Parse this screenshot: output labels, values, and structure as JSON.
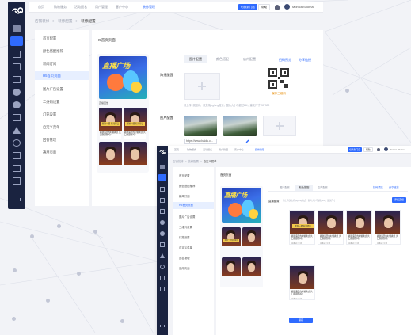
{
  "colors": {
    "accent": "#2f6bff",
    "sidebar": "#1a2340",
    "warning": "#e68a00"
  },
  "window1": {
    "topnav": [
      "首页",
      "购物服务",
      "活动报名",
      "用户管理",
      "客户中心",
      "装修管理"
    ],
    "topnav_active_index": 5,
    "top_buttons": {
      "primary": "切换到门店",
      "secondary": "帮助"
    },
    "user_name": "Monica Shoma",
    "breadcrumb": [
      "店铺装修",
      "装修配置",
      "装修配置"
    ],
    "menu": [
      "首页配置",
      "颜色搭配推荐",
      "新闻订阅",
      "H5首页页面",
      "图片广告设置",
      "二维码设置",
      "灯笼设置",
      "自定义菜单",
      "回答管理",
      "通用页面"
    ],
    "menu_active_index": 3,
    "main_title": "H5首页页面",
    "phone": {
      "banner_title": "直播广场",
      "strip_text": "直播回放",
      "card_ribbon": "刚准一把\n有闻得口",
      "card_caption": "刷新露天的时候换点\n共口新颜色吗？"
    },
    "tabs": [
      "图片配置",
      "颜色搭配",
      "店内配置"
    ],
    "tab_active_index": 0,
    "links": {
      "share": "扫码预览",
      "edit": "分享链接"
    },
    "labels": {
      "banner": "海报配置",
      "image": "图片配置"
    },
    "hint": "请上传1张图片，仅支持jpg/png格式，图片大小不超过2M，建议尺寸750*300",
    "qr_text": "保存二维码",
    "url_value": "https://www.baidu.c..."
  },
  "window2": {
    "topnav": [
      "首页",
      "购物服务",
      "活动报名",
      "用户管理",
      "客户中心",
      "装修管理"
    ],
    "topnav_active_index": 5,
    "top_buttons": {
      "primary": "切换到门店",
      "secondary": "帮助"
    },
    "user_name": "Monica Shoma",
    "breadcrumb": [
      "店铺装修",
      "装修配置",
      "自定义菜单"
    ],
    "menu": [
      "首页配置",
      "颜色搭配推荐",
      "新闻订阅",
      "H5首页页面",
      "图片广告设置",
      "二维码设置",
      "灯笼设置",
      "自定义菜单",
      "回答管理",
      "通用页面"
    ],
    "menu_active_index": 3,
    "main_title": "首页页面",
    "tabs": [
      "图片配置",
      "颜色搭配",
      "店内配置"
    ],
    "tab_active_index": 1,
    "links": {
      "share": "扫码预览",
      "edit": "分享链接"
    },
    "section_label": "直播配置",
    "hint": "请上传仅支持jpg/png格式，图片大小不超过2M，建议尺寸",
    "add_button": "添加直播",
    "card_caption": "刷新露天的时候换点\n共口新颜色吗？",
    "card_meta": "直播间已关闭",
    "save_button": "保存"
  }
}
